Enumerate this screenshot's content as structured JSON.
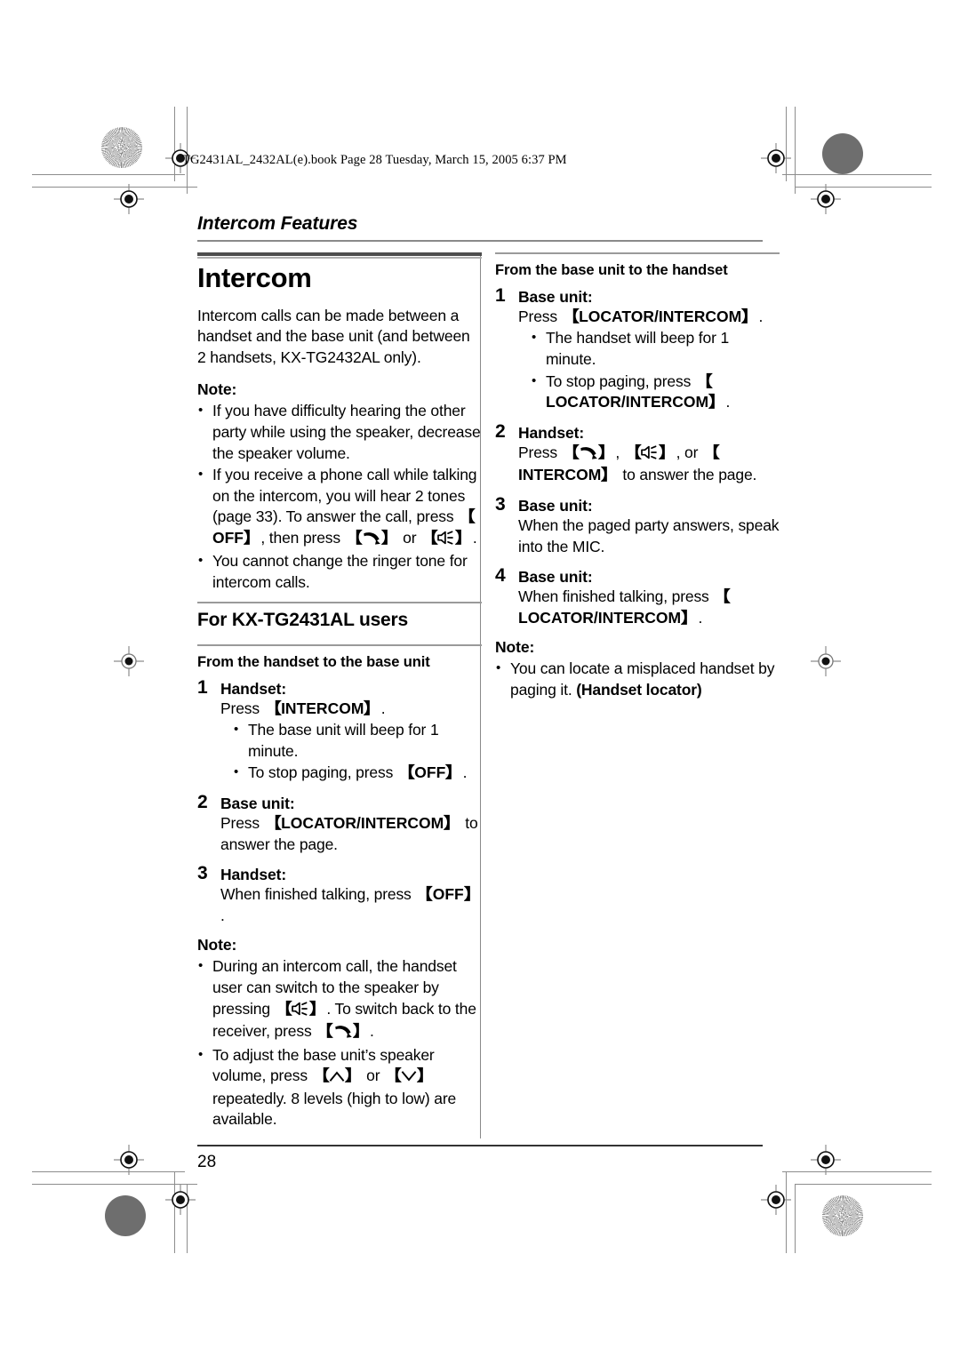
{
  "page": {
    "file_stamp": "TG2431AL_2432AL(e).book  Page 28  Tuesday, March 15, 2005  6:37 PM",
    "running_head": "Intercom Features",
    "page_number": "28"
  },
  "left_column": {
    "chapter_title": "Intercom",
    "intro": "Intercom calls can be made between a handset and the base unit (and between 2 handsets, KX-TG2432AL only).",
    "note_label": "Note:",
    "notes": [
      {
        "parts": [
          {
            "t": "text",
            "v": "If you have difficulty hearing the other party while using the speaker, decrease the speaker volume."
          }
        ]
      },
      {
        "parts": [
          {
            "t": "text",
            "v": "If you receive a phone call while talking on the intercom, you will hear 2 tones (page 33). To answer the call, press "
          },
          {
            "t": "key",
            "v": "OFF"
          },
          {
            "t": "text",
            "v": ", then press "
          },
          {
            "t": "keyicon",
            "v": "handset-talk-icon"
          },
          {
            "t": "text",
            "v": " or "
          },
          {
            "t": "keyicon",
            "v": "speakerphone-icon"
          },
          {
            "t": "text",
            "v": "."
          }
        ]
      },
      {
        "parts": [
          {
            "t": "text",
            "v": "You cannot change the ringer tone for intercom calls."
          }
        ]
      }
    ],
    "section_title": "For KX-TG2431AL users",
    "subsection_title": "From the handset to the base unit",
    "steps": [
      {
        "num": "1",
        "who": "Handset:",
        "action": [
          {
            "t": "text",
            "v": "Press "
          },
          {
            "t": "key",
            "v": "INTERCOM"
          },
          {
            "t": "text",
            "v": "."
          }
        ],
        "bullets": [
          [
            {
              "t": "text",
              "v": "The base unit will beep for 1 minute."
            }
          ],
          [
            {
              "t": "text",
              "v": "To stop paging, press "
            },
            {
              "t": "key",
              "v": "OFF"
            },
            {
              "t": "text",
              "v": "."
            }
          ]
        ]
      },
      {
        "num": "2",
        "who": "Base unit:",
        "action": [
          {
            "t": "text",
            "v": "Press "
          },
          {
            "t": "key",
            "v": "LOCATOR/INTERCOM"
          },
          {
            "t": "text",
            "v": " to answer the page."
          }
        ],
        "bullets": []
      },
      {
        "num": "3",
        "who": "Handset:",
        "action": [
          {
            "t": "text",
            "v": "When finished talking, press "
          },
          {
            "t": "key",
            "v": "OFF"
          },
          {
            "t": "text",
            "v": "."
          }
        ],
        "bullets": []
      }
    ],
    "note_label_2": "Note:",
    "notes_2": [
      {
        "parts": [
          {
            "t": "text",
            "v": "During an intercom call, the handset user can switch to the speaker by pressing "
          },
          {
            "t": "keyicon",
            "v": "speakerphone-icon"
          },
          {
            "t": "text",
            "v": ". To switch back to the receiver, press "
          },
          {
            "t": "keyicon",
            "v": "handset-talk-icon"
          },
          {
            "t": "text",
            "v": "."
          }
        ]
      },
      {
        "parts": [
          {
            "t": "text",
            "v": "To adjust the base unit’s speaker volume, press "
          },
          {
            "t": "keyicon",
            "v": "volume-up-icon"
          },
          {
            "t": "text",
            "v": " or "
          },
          {
            "t": "keyicon",
            "v": "volume-down-icon"
          },
          {
            "t": "text",
            "v": " repeatedly. 8 levels (high to low) are available."
          }
        ]
      }
    ]
  },
  "right_column": {
    "subsection_title": "From the base unit to the handset",
    "steps": [
      {
        "num": "1",
        "who": "Base unit:",
        "action": [
          {
            "t": "text",
            "v": "Press "
          },
          {
            "t": "key",
            "v": "LOCATOR/INTERCOM"
          },
          {
            "t": "text",
            "v": "."
          }
        ],
        "bullets": [
          [
            {
              "t": "text",
              "v": "The handset will beep for 1 minute."
            }
          ],
          [
            {
              "t": "text",
              "v": "To stop paging, press "
            },
            {
              "t": "key",
              "v": "LOCATOR/INTERCOM"
            },
            {
              "t": "text",
              "v": "."
            }
          ]
        ]
      },
      {
        "num": "2",
        "who": "Handset:",
        "action": [
          {
            "t": "text",
            "v": "Press "
          },
          {
            "t": "keyicon",
            "v": "handset-talk-icon"
          },
          {
            "t": "text",
            "v": ", "
          },
          {
            "t": "keyicon",
            "v": "speakerphone-icon"
          },
          {
            "t": "text",
            "v": ", or "
          },
          {
            "t": "key",
            "v": "INTERCOM"
          },
          {
            "t": "text",
            "v": " to answer the page."
          }
        ],
        "bullets": []
      },
      {
        "num": "3",
        "who": "Base unit:",
        "action": [
          {
            "t": "text",
            "v": "When the paged party answers, speak into the MIC."
          }
        ],
        "bullets": []
      },
      {
        "num": "4",
        "who": "Base unit:",
        "action": [
          {
            "t": "text",
            "v": "When finished talking, press "
          },
          {
            "t": "key",
            "v": "LOCATOR/INTERCOM"
          },
          {
            "t": "text",
            "v": "."
          }
        ],
        "bullets": []
      }
    ],
    "note_label": "Note:",
    "notes": [
      {
        "parts": [
          {
            "t": "text",
            "v": "You can locate a misplaced handset by paging it. "
          },
          {
            "t": "bold",
            "v": "(Handset locator)"
          }
        ]
      }
    ]
  },
  "colors": {
    "rule_dark": "#4d4d4d",
    "rule_light": "#9a9a9a",
    "mark_gray": "#8d8d8d"
  }
}
